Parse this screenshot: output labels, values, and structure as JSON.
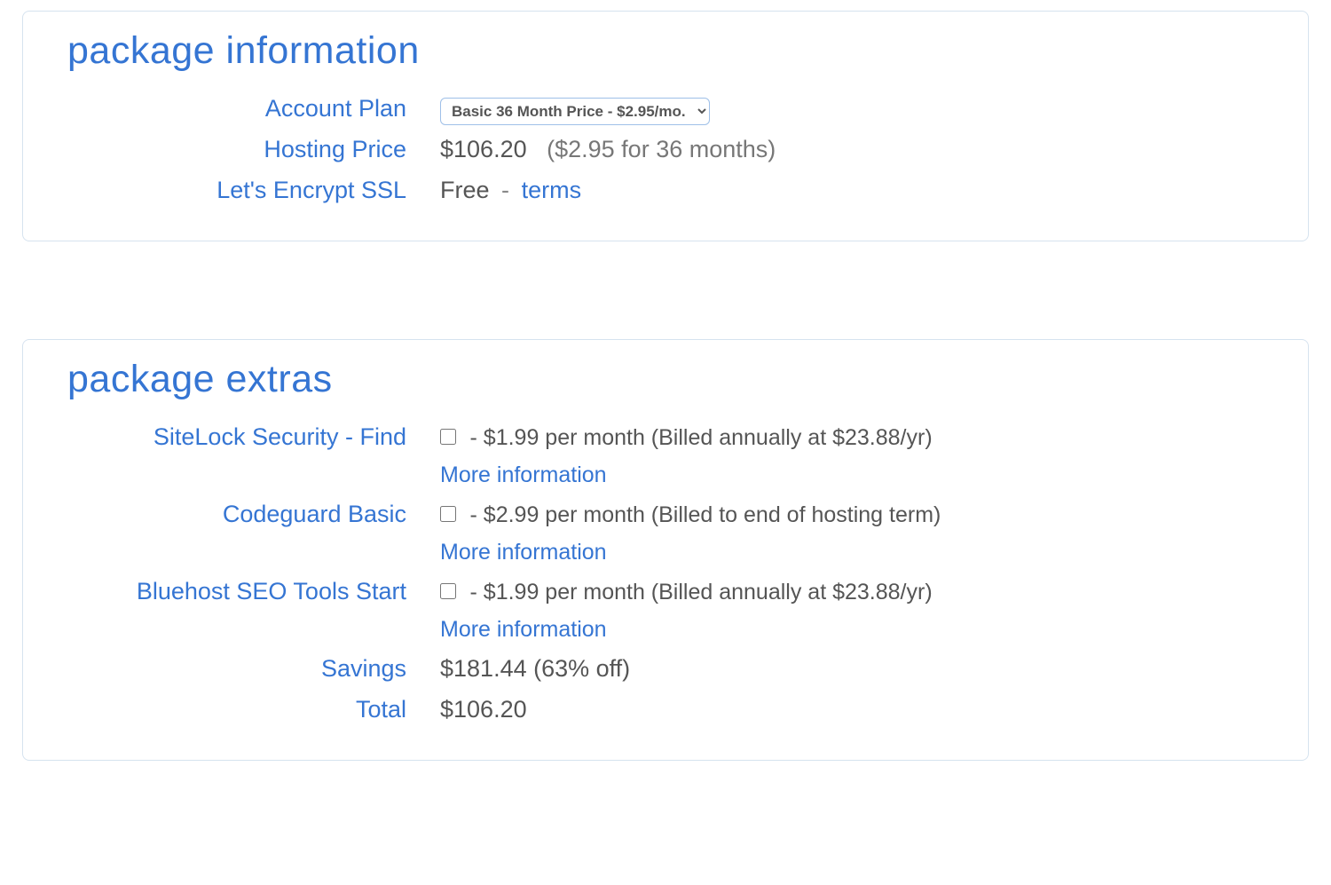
{
  "packageInfo": {
    "title": "package information",
    "rows": {
      "accountPlan": {
        "label": "Account Plan",
        "selected": "Basic 36 Month Price - $2.95/mo."
      },
      "hostingPrice": {
        "label": "Hosting Price",
        "price": "$106.20",
        "detail": "($2.95 for 36 months)"
      },
      "ssl": {
        "label": "Let's Encrypt SSL",
        "value": "Free",
        "separator": "-",
        "termsLink": "terms"
      }
    }
  },
  "packageExtras": {
    "title": "package extras",
    "items": [
      {
        "label": "SiteLock Security - Find",
        "priceText": "- $1.99 per month (Billed annually at $23.88/yr)",
        "moreInfo": "More information"
      },
      {
        "label": "Codeguard Basic",
        "priceText": "- $2.99 per month (Billed to end of hosting term)",
        "moreInfo": "More information"
      },
      {
        "label": "Bluehost SEO Tools Start",
        "priceText": "- $1.99 per month (Billed annually at $23.88/yr)",
        "moreInfo": "More information"
      }
    ],
    "savings": {
      "label": "Savings",
      "value": "$181.44 (63% off)"
    },
    "total": {
      "label": "Total",
      "value": "$106.20"
    }
  }
}
